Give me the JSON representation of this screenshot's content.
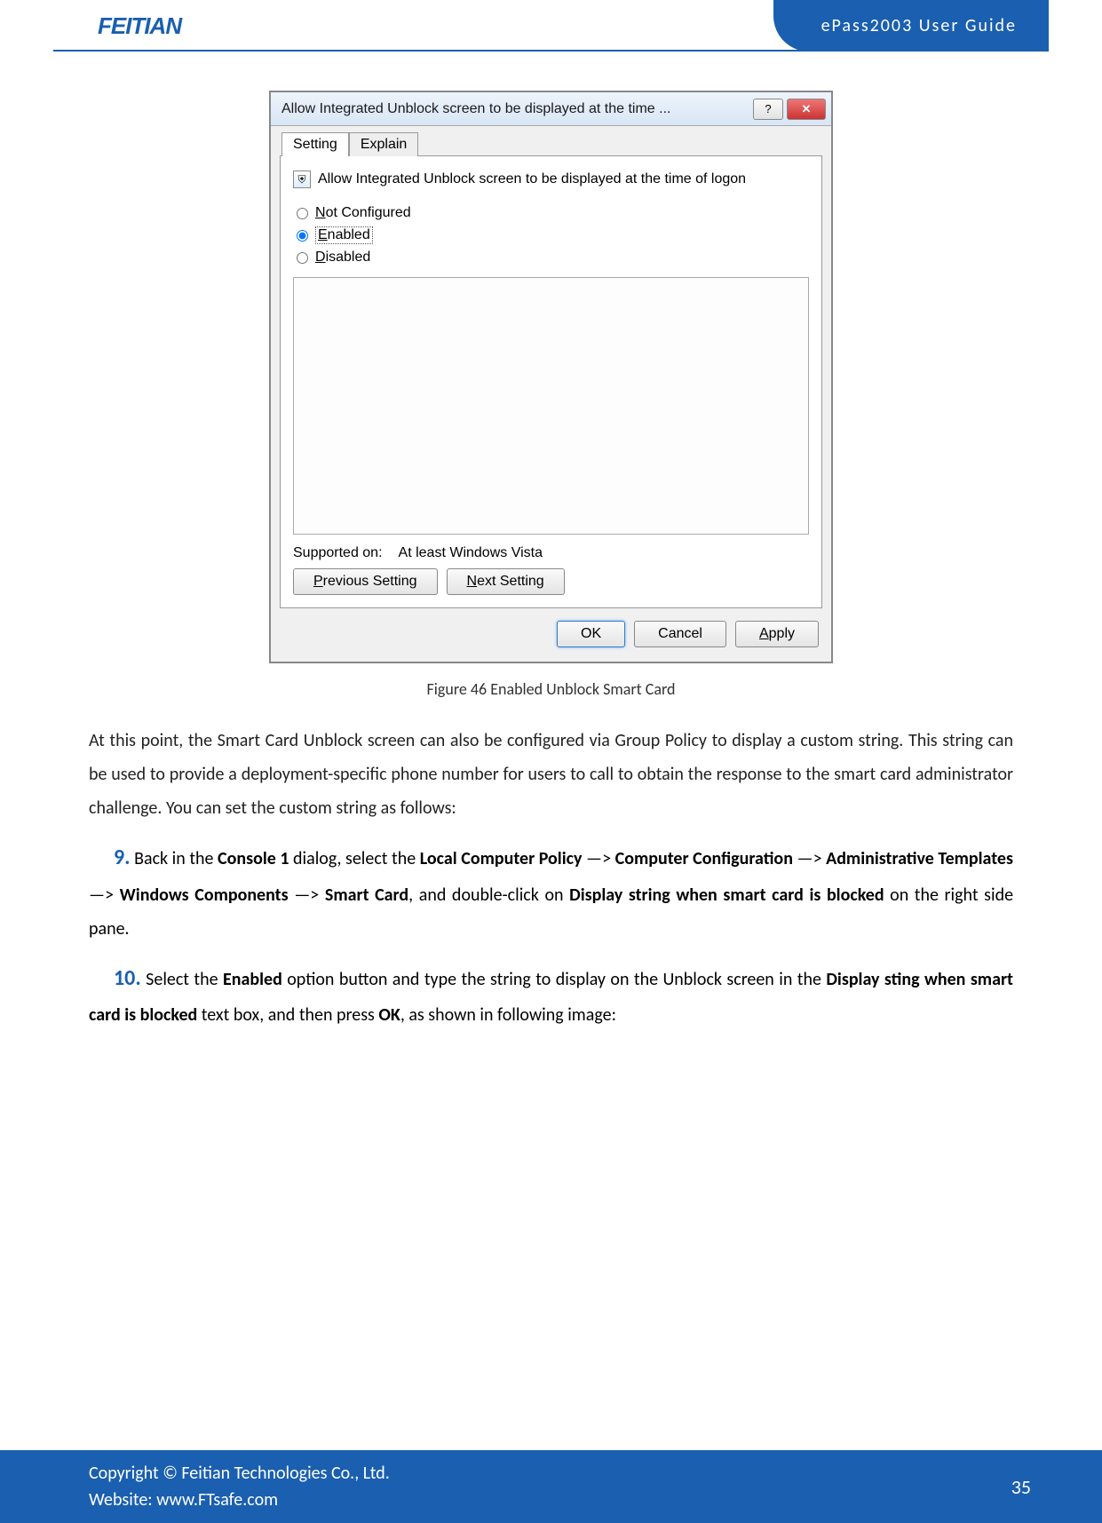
{
  "header": {
    "logo": "FEITIAN",
    "doc_title": "ePass2003  User  Guide"
  },
  "dialog": {
    "title": "Allow Integrated Unblock screen to be displayed at the time ...",
    "help_btn": "?",
    "close_btn": "✕",
    "tab_setting": "Setting",
    "tab_explain": "Explain",
    "setting_label": "Allow Integrated Unblock screen to be displayed at the time of logon",
    "opt_not_configured": "Not Configured",
    "opt_enabled": "Enabled",
    "opt_disabled": "Disabled",
    "supported_label": "Supported on:",
    "supported_value": "At least Windows Vista",
    "prev_btn": "Previous Setting",
    "next_btn": "Next Setting",
    "ok_btn": "OK",
    "cancel_btn": "Cancel",
    "apply_btn": "Apply"
  },
  "caption": "Figure 46 Enabled Unblock Smart Card",
  "para1": "At this point, the Smart Card Unblock screen can also be configured via Group Policy to display a custom string. This string can be used to provide a deployment-specific phone number for users to call to obtain the response to the smart card administrator challenge. You can set the custom string as follows:",
  "step9": {
    "num": "9.",
    "t1": "Back  in  the ",
    "b1": "Console 1",
    "t2": "  dialog,  select  the ",
    "b2": "Local  Computer  Policy",
    "t3": "  —> ",
    "b3": "Computer  Configuration",
    "t4": "  —> ",
    "b4": "Administrative Templates",
    "t5": " —> ",
    "b5": "Windows Components",
    "t6": " —> ",
    "b6": "Smart Card",
    "t7": ", and double-click on ",
    "b7": "Display string when smart card is blocked",
    "t8": " on the right side pane."
  },
  "step10": {
    "num": "10.",
    "t1": "Select the ",
    "b1": "Enabled",
    "t2": " option button and type the string to display on the Unblock screen in the ",
    "b2": "Display sting when smart card is blocked",
    "t3": " text box, and then press ",
    "b3": "OK",
    "t4": ", as shown in following image:"
  },
  "footer": {
    "copyright": "Copyright © Feitian Technologies Co., Ltd.",
    "website": "Website: www.FTsafe.com",
    "page": "35"
  }
}
